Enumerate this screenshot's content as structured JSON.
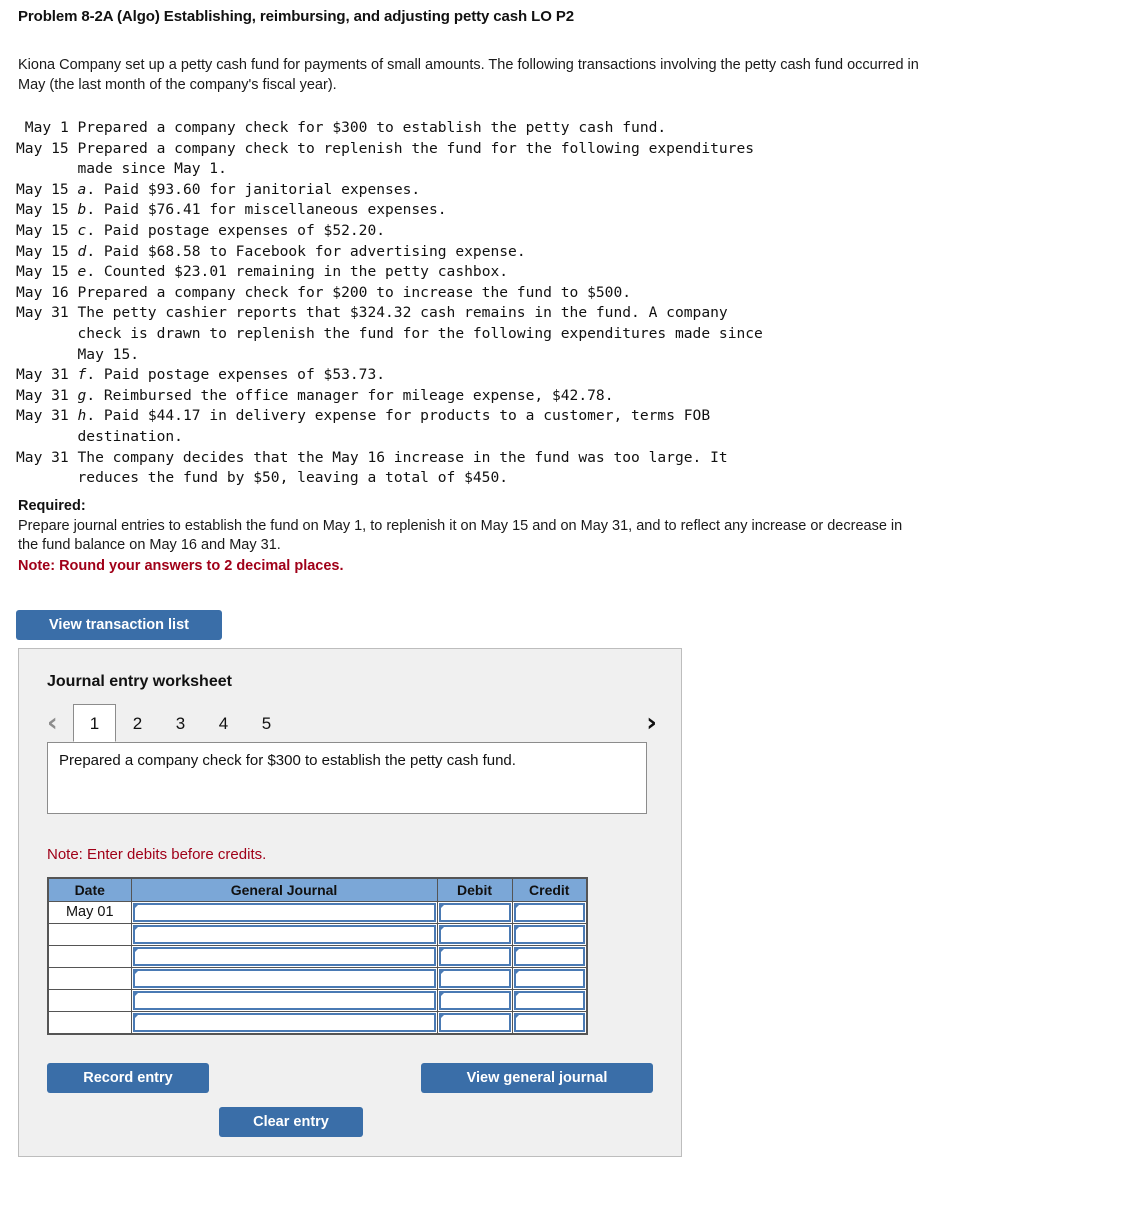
{
  "problem": {
    "title": "Problem 8-2A (Algo) Establishing, reimbursing, and adjusting petty cash LO P2",
    "intro": "Kiona Company set up a petty cash fund for payments of small amounts. The following transactions involving the petty cash fund occurred in May (the last month of the company's fiscal year)."
  },
  "transactions": [
    " May 1 Prepared a company check for $300 to establish the petty cash fund.",
    "May 15 Prepared a company check to replenish the fund for the following expenditures\n       made since May 1.",
    "May 15 a. Paid $93.60 for janitorial expenses.",
    "May 15 b. Paid $76.41 for miscellaneous expenses.",
    "May 15 c. Paid postage expenses of $52.20.",
    "May 15 d. Paid $68.58 to Facebook for advertising expense.",
    "May 15 e. Counted $23.01 remaining in the petty cashbox.",
    "May 16 Prepared a company check for $200 to increase the fund to $500.",
    "May 31 The petty cashier reports that $324.32 cash remains in the fund. A company\n       check is drawn to replenish the fund for the following expenditures made since\n       May 15.",
    "May 31 f. Paid postage expenses of $53.73.",
    "May 31 g. Reimbursed the office manager for mileage expense, $42.78.",
    "May 31 h. Paid $44.17 in delivery expense for products to a customer, terms FOB\n       destination.",
    "May 31 The company decides that the May 16 increase in the fund was too large. It\n       reduces the fund by $50, leaving a total of $450."
  ],
  "required": {
    "label": "Required:",
    "text": "Prepare journal entries to establish the fund on May 1, to replenish it on May 15 and on May 31, and to reflect any increase or decrease in the fund balance on May 16 and May 31.",
    "round_note": "Note: Round your answers to 2 decimal places."
  },
  "buttons": {
    "view_transaction_list": "View transaction list",
    "record_entry": "Record entry",
    "clear_entry": "Clear entry",
    "view_general_journal": "View general journal"
  },
  "worksheet": {
    "title": "Journal entry worksheet",
    "prev_icon": "chevron-left-icon",
    "next_icon": "chevron-right-icon",
    "prev_glyph": "‹",
    "next_glyph": "›",
    "tabs": [
      "1",
      "2",
      "3",
      "4",
      "5"
    ],
    "active_tab": "1",
    "description": "Prepared a company check for $300 to establish the petty cash fund.",
    "debits_note": "Note: Enter debits before credits.",
    "table": {
      "headers": [
        "Date",
        "General Journal",
        "Debit",
        "Credit"
      ],
      "rows": [
        {
          "date": "May 01",
          "general_journal": "",
          "debit": "",
          "credit": ""
        },
        {
          "date": "",
          "general_journal": "",
          "debit": "",
          "credit": ""
        },
        {
          "date": "",
          "general_journal": "",
          "debit": "",
          "credit": ""
        },
        {
          "date": "",
          "general_journal": "",
          "debit": "",
          "credit": ""
        },
        {
          "date": "",
          "general_journal": "",
          "debit": "",
          "credit": ""
        },
        {
          "date": "",
          "general_journal": "",
          "debit": "",
          "credit": ""
        }
      ]
    }
  },
  "colors": {
    "button_blue": "#3a6ea8",
    "table_header_blue": "#7ba7d7",
    "select_border_blue": "#4a7ab4",
    "note_red": "#a00018",
    "panel_bg": "#f0f0f0",
    "panel_border": "#bdbdbd"
  }
}
